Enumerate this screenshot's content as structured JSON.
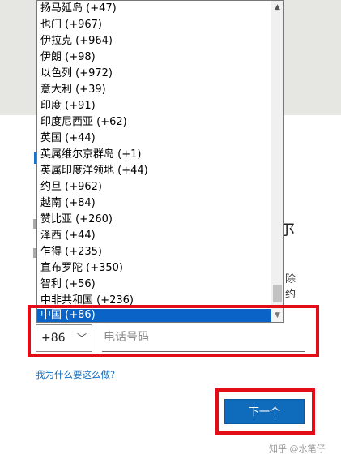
{
  "dropdown": {
    "items": [
      "扬马延岛 (+47)",
      "也门 (+967)",
      "伊拉克 (+964)",
      "伊朗 (+98)",
      "以色列 (+972)",
      "意大利 (+39)",
      "印度 (+91)",
      "印度尼西亚 (+62)",
      "英国 (+44)",
      "英属维尔京群岛 (+1)",
      "英属印度洋领地 (+44)",
      "约旦 (+962)",
      "越南 (+84)",
      "赞比亚 (+260)",
      "泽西 (+44)",
      "乍得 (+235)",
      "直布罗陀 (+350)",
      "智利 (+56)",
      "中非共和国 (+236)"
    ],
    "selected": "中国 (+86)"
  },
  "page_fragments": {
    "heading_tail": "尔",
    "line1_tail": "除",
    "line2_tail": "约"
  },
  "phone": {
    "country_code": "+86",
    "placeholder": "电话号码"
  },
  "why_link": "我为什么要这么做?",
  "next_button": "下一个",
  "watermark": "知乎 @水笔仔",
  "colors": {
    "accent": "#0f6cbd",
    "selection": "#0a64c8",
    "highlight": "#e30d17",
    "link": "#1a6fc0"
  }
}
